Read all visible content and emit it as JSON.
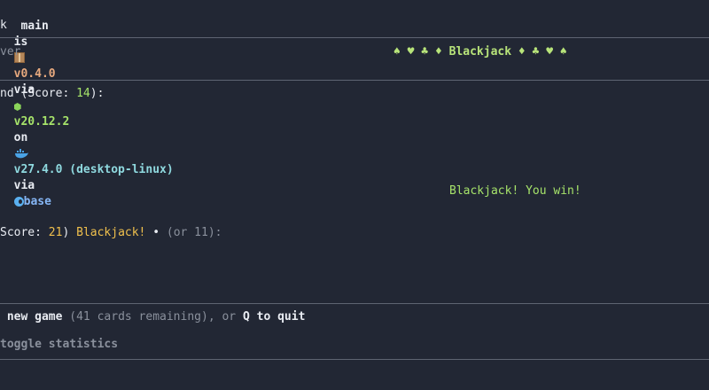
{
  "prompt": {
    "branch_prefix": " main",
    "is": "is",
    "package_version": "v0.4.0",
    "via1": "via",
    "node_version": "v20.12.2",
    "on": "on",
    "docker_version": "v27.4.0 (desktop-linux)",
    "via2": "via",
    "conda_env": "base",
    "second_line": "k"
  },
  "header": {
    "left_text": "ver",
    "title_suits_left": "♠ ♥ ♣ ♦",
    "title": "Blackjack",
    "title_suits_right": "♦ ♣ ♥ ♠"
  },
  "dealer": {
    "label": "nd (Score: ",
    "score": "14",
    "label_end": "):"
  },
  "result": {
    "message": "Blackjack! You win!"
  },
  "player": {
    "label": "Score: ",
    "score": "21",
    "paren_close": ")",
    "blackjack": "Blackjack!",
    "bullet": "•",
    "alt": "(or 11):"
  },
  "footer": {
    "new_game": " new game",
    "cards_remaining": "(41 cards remaining),",
    "or": "or",
    "quit_key": "Q",
    "to_quit": "to quit",
    "toggle_stats": "toggle statistics"
  },
  "colors": {
    "background": "#222734",
    "success": "#a6e36a",
    "score_highlight": "#f0c04d"
  }
}
